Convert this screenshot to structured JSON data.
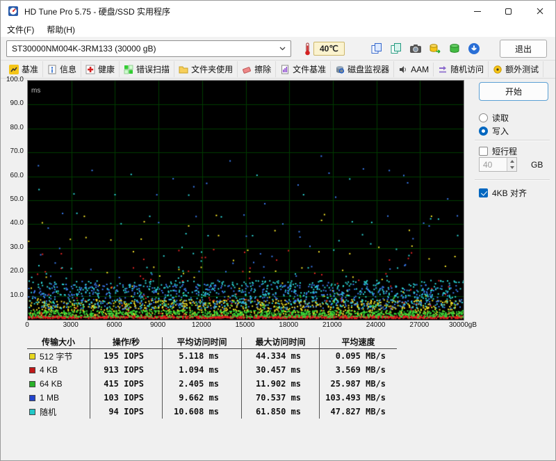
{
  "window": {
    "title": "HD Tune Pro 5.75 - 硬盘/SSD 实用程序"
  },
  "menu": {
    "file": "文件(F)",
    "help": "帮助(H)"
  },
  "toolbar": {
    "drive_select": "ST30000NM004K-3RM133 (30000 gB)",
    "temperature": "40℃",
    "exit_label": "退出"
  },
  "tabs": [
    {
      "label": "基准"
    },
    {
      "label": "信息"
    },
    {
      "label": "健康"
    },
    {
      "label": "错误扫描"
    },
    {
      "label": "文件夹使用"
    },
    {
      "label": "擦除"
    },
    {
      "label": "文件基准"
    },
    {
      "label": "磁盘监视器"
    },
    {
      "label": "AAM"
    },
    {
      "label": "随机访问"
    },
    {
      "label": "额外测试"
    }
  ],
  "controls": {
    "start_label": "开始",
    "read_label": "读取",
    "read_selected": false,
    "write_label": "写入",
    "write_selected": true,
    "short_stroke_label": "短行程",
    "short_stroke_checked": false,
    "short_stroke_value": "40",
    "short_stroke_unit": "GB",
    "align_label": "4KB 对齐",
    "align_checked": true
  },
  "chart_data": {
    "type": "scatter",
    "title": "Random access write latency scatter",
    "ylabel": "ms",
    "xlabel": "",
    "ylim": [
      0,
      100
    ],
    "xlim": [
      0,
      30000
    ],
    "grid": true,
    "bg_color": "#000000",
    "grid_color": "#003c00",
    "y_ticks": [
      "100.0",
      "90.0",
      "80.0",
      "70.0",
      "60.0",
      "50.0",
      "40.0",
      "30.0",
      "20.0",
      "10.0"
    ],
    "x_ticks": [
      "0",
      "3000",
      "6000",
      "9000",
      "12000",
      "15000",
      "18000",
      "21000",
      "24000",
      "27000",
      "30000gB"
    ],
    "series": [
      {
        "name": "512 字节",
        "color": "#f4e428",
        "avg_ms": 5.118,
        "max_ms": 44.334,
        "points": 820,
        "spread": 0.65,
        "spike_p": 0.1
      },
      {
        "name": "4 KB",
        "color": "#e42424",
        "avg_ms": 1.094,
        "max_ms": 30.457,
        "points": 1250,
        "spread": 0.45,
        "spike_p": 0.09
      },
      {
        "name": "64 KB",
        "color": "#38d438",
        "avg_ms": 2.405,
        "max_ms": 11.902,
        "points": 900,
        "spread": 0.6,
        "spike_p": 0.15
      },
      {
        "name": "1 MB",
        "color": "#3a7cf0",
        "avg_ms": 9.662,
        "max_ms": 70.537,
        "points": 660,
        "spread": 0.55,
        "spike_p": 0.12
      },
      {
        "name": "随机",
        "color": "#2cd8d8",
        "avg_ms": 10.608,
        "max_ms": 61.85,
        "points": 660,
        "spread": 0.55,
        "spike_p": 0.12
      }
    ]
  },
  "table": {
    "headers": [
      "传输大小",
      "操作/秒",
      "平均访问时间",
      "最大访问时间",
      "平均速度"
    ],
    "rows": [
      {
        "color": "#e8d820",
        "label": "512 字节",
        "iops": "195 IOPS",
        "avg": "5.118 ms",
        "max": "44.334 ms",
        "speed": "0.095 MB/s"
      },
      {
        "color": "#c01818",
        "label": "4 KB",
        "iops": "913 IOPS",
        "avg": "1.094 ms",
        "max": "30.457 ms",
        "speed": "3.569 MB/s"
      },
      {
        "color": "#28b028",
        "label": "64 KB",
        "iops": "415 IOPS",
        "avg": "2.405 ms",
        "max": "11.902 ms",
        "speed": "25.987 MB/s"
      },
      {
        "color": "#2244cc",
        "label": "1 MB",
        "iops": "103 IOPS",
        "avg": "9.662 ms",
        "max": "70.537 ms",
        "speed": "103.493 MB/s"
      },
      {
        "color": "#22c8c8",
        "label": "随机",
        "iops": "94 IOPS",
        "avg": "10.608 ms",
        "max": "61.850 ms",
        "speed": "47.827 MB/s"
      }
    ]
  }
}
